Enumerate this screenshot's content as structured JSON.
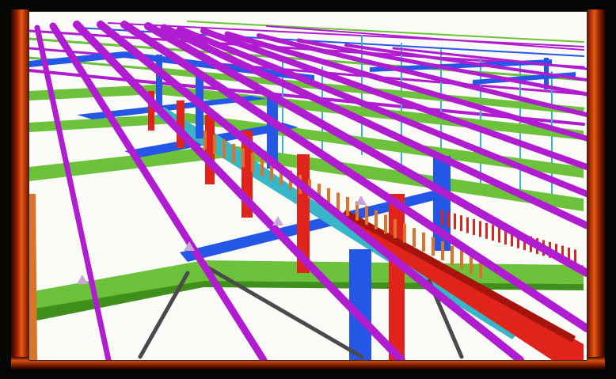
{
  "scene": {
    "subject": "3d-steel-structure-model",
    "colors": {
      "purple": "#b01ccf",
      "blue": "#2457e6",
      "green": "#6cc23a",
      "green_dark": "#3f8f1c",
      "red": "#e0241b",
      "cyan": "#36b6c6",
      "orange": "#d9742a",
      "gray": "#4a4a4a",
      "background": "#fbfbf8",
      "frame": "#050505",
      "flame": "#e65a10"
    }
  }
}
